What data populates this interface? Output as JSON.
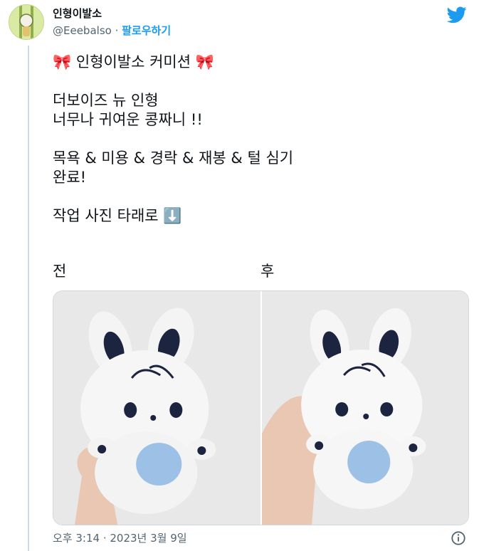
{
  "author": {
    "display_name": "인형이발소",
    "handle": "@Eeebalso",
    "separator": " · ",
    "follow_label": "팔로우하기"
  },
  "tweet": {
    "text": "🎀 인형이발소 커미션 🎀\n\n더보이즈 뉴 인형\n너무나 귀여운 콩짜니 !!\n\n목욕 & 미용 & 경락 & 재봉 & 털 심기\n완료!\n\n작업 사진 타래로 ⬇️"
  },
  "photos": {
    "before_label": "전",
    "after_label": "후"
  },
  "meta": {
    "timestamp": "오후 3:14 · 2023년 3월 9일"
  },
  "icons": {
    "brand": "twitter-bird-icon",
    "info": "info-icon"
  },
  "colors": {
    "accent": "#1d9bf0",
    "muted": "#536471",
    "border": "#cfd9de",
    "plush_ear_inner": "#1c2440",
    "plush_belly": "#9cc0e6"
  }
}
